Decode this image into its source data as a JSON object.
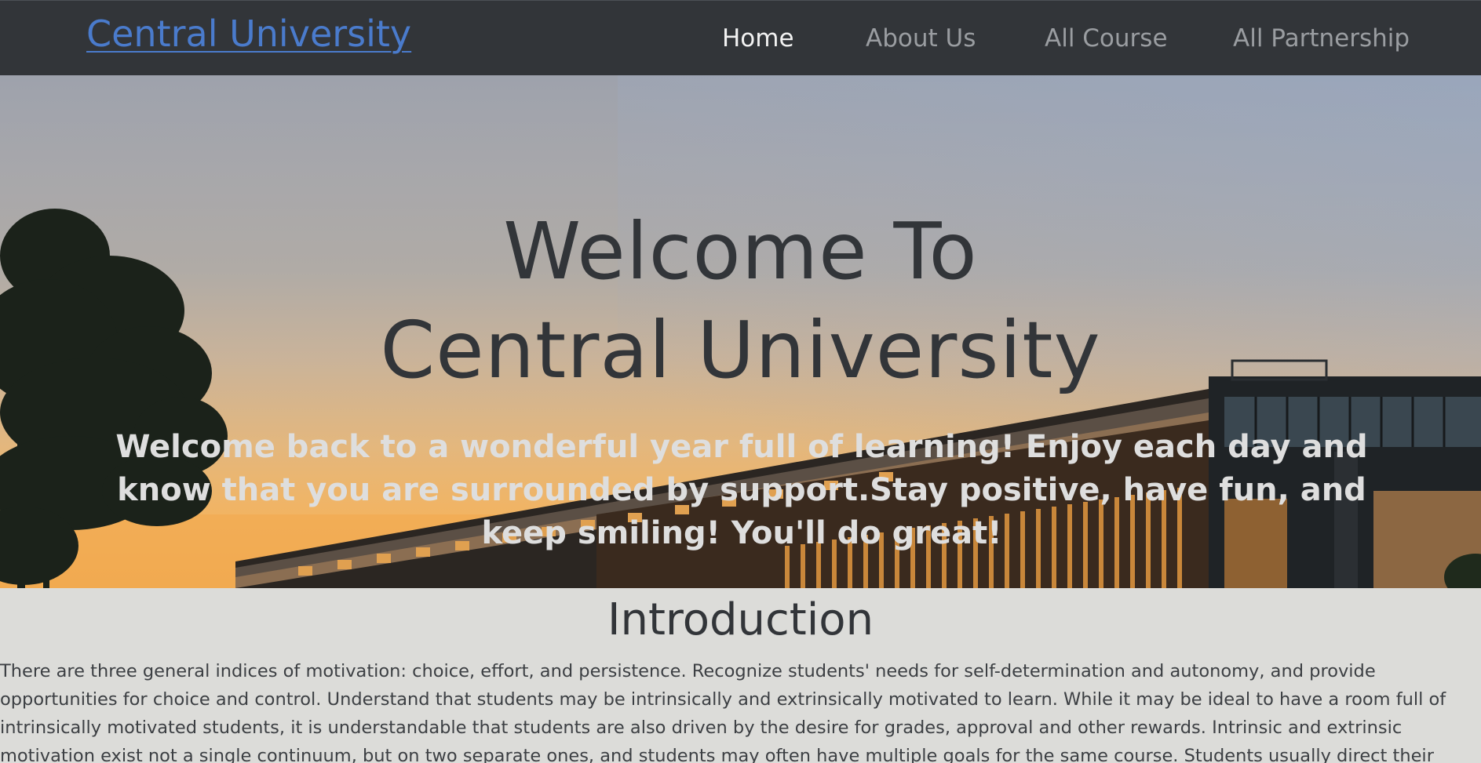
{
  "navbar": {
    "brand": "Central University",
    "links": [
      {
        "label": "Home",
        "active": true
      },
      {
        "label": "About Us",
        "active": false
      },
      {
        "label": "All Course",
        "active": false
      },
      {
        "label": "All Partnership",
        "active": false
      }
    ]
  },
  "hero": {
    "title_line1": "Welcome To",
    "title_line2": "Central University",
    "subtitle": "Welcome back to a wonderful year full of learning! Enjoy each day and know that you are surrounded by support.Stay positive, have fun, and keep smiling! You'll do great!"
  },
  "intro": {
    "heading": "Introduction",
    "body": "There are three general indices of motivation: choice, effort, and persistence. Recognize students' needs for self-determination and autonomy, and provide opportunities for choice and control. Understand that students may be intrinsically and extrinsically motivated to learn. While it may be ideal to have a room full of intrinsically motivated students, it is understandable that students are also driven by the desire for grades, approval and other rewards. Intrinsic and extrinsic motivation exist not a single continuum, but on two separate ones, and students may often have multiple goals for the same course. Students usually direct their behavior toward activities that they value and in which they have"
  },
  "colors": {
    "navbar_bg": "#323539",
    "brand_link": "#4a7bcc",
    "nav_active": "#f2f2f2",
    "nav_inactive": "#9a9da1",
    "hero_text_dark": "#323539",
    "hero_text_light": "#dedede",
    "page_bg": "#dcdcd9"
  }
}
